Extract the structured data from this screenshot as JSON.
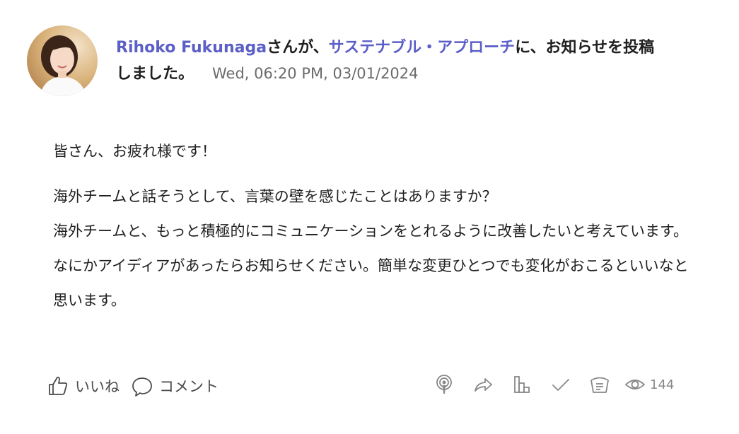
{
  "header": {
    "author": "Rihoko Fukunaga",
    "text_1": "さんが、",
    "community": "サステナブル・アプローチ",
    "text_2": "に、お知らせを投稿しました。",
    "timestamp": "Wed, 06:20 PM, 03/01/2024"
  },
  "body": {
    "greeting": "皆さん、お疲れ様です！",
    "paragraph": "海外チームと話そうとして、言葉の壁を感じたことはありますか？\n海外チームと、もっと積極的にコミュニケーションをとれるように改善したいと考えています。なにかアイディアがあったらお知らせください。簡単な変更ひとつでも変化がおこるといいなと思います。"
  },
  "footer": {
    "like_label": "いいね",
    "comment_label": "コメント",
    "view_count": "144",
    "icons": [
      "podcast-icon",
      "share-icon",
      "analytics-icon",
      "checkmark-icon",
      "notes-icon",
      "eye-icon"
    ]
  },
  "colors": {
    "link": "#5b5fc7",
    "text": "#1f1f1f",
    "muted": "#6b6b6b",
    "icon": "#888888"
  }
}
